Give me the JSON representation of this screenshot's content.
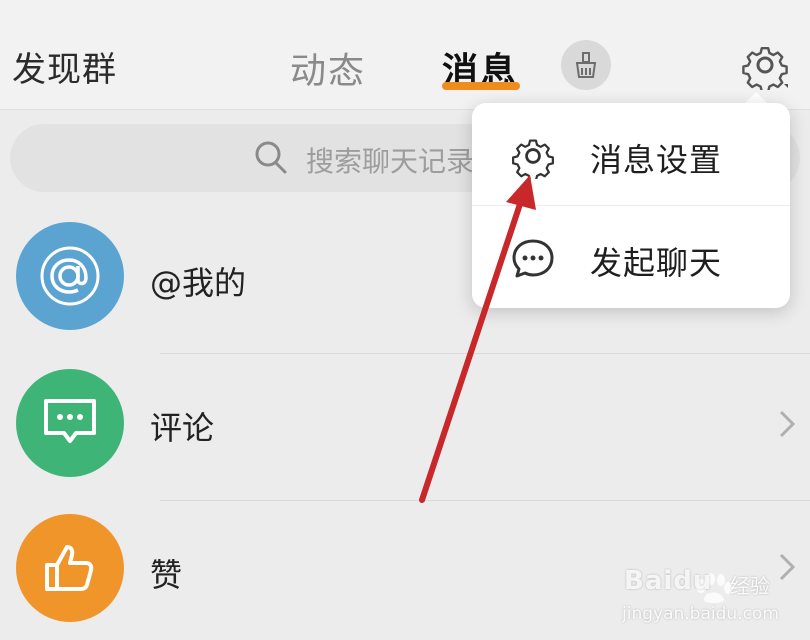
{
  "header": {
    "discover_label": "发现群",
    "tabs": [
      {
        "label": "动态",
        "active": false
      },
      {
        "label": "消息",
        "active": true
      }
    ],
    "broom_icon": "broom-icon",
    "settings_icon": "gear-icon"
  },
  "search": {
    "placeholder": "搜索聊天记录",
    "icon": "search-icon"
  },
  "list": [
    {
      "label": "@我的",
      "icon": "at-icon",
      "color": "#5ba4d2"
    },
    {
      "label": "评论",
      "icon": "comment-icon",
      "color": "#3fb477"
    },
    {
      "label": "赞",
      "icon": "thumbs-up-icon",
      "color": "#f0952a"
    }
  ],
  "menu": {
    "items": [
      {
        "label": "消息设置",
        "icon": "gear-icon"
      },
      {
        "label": "发起聊天",
        "icon": "chat-bubble-icon"
      }
    ]
  },
  "colors": {
    "accent": "#f08c1e",
    "annotation_arrow": "#c8282a"
  },
  "watermark": {
    "brand": "Baidu",
    "sub": "经验",
    "url": "jingyan.baidu.com"
  }
}
